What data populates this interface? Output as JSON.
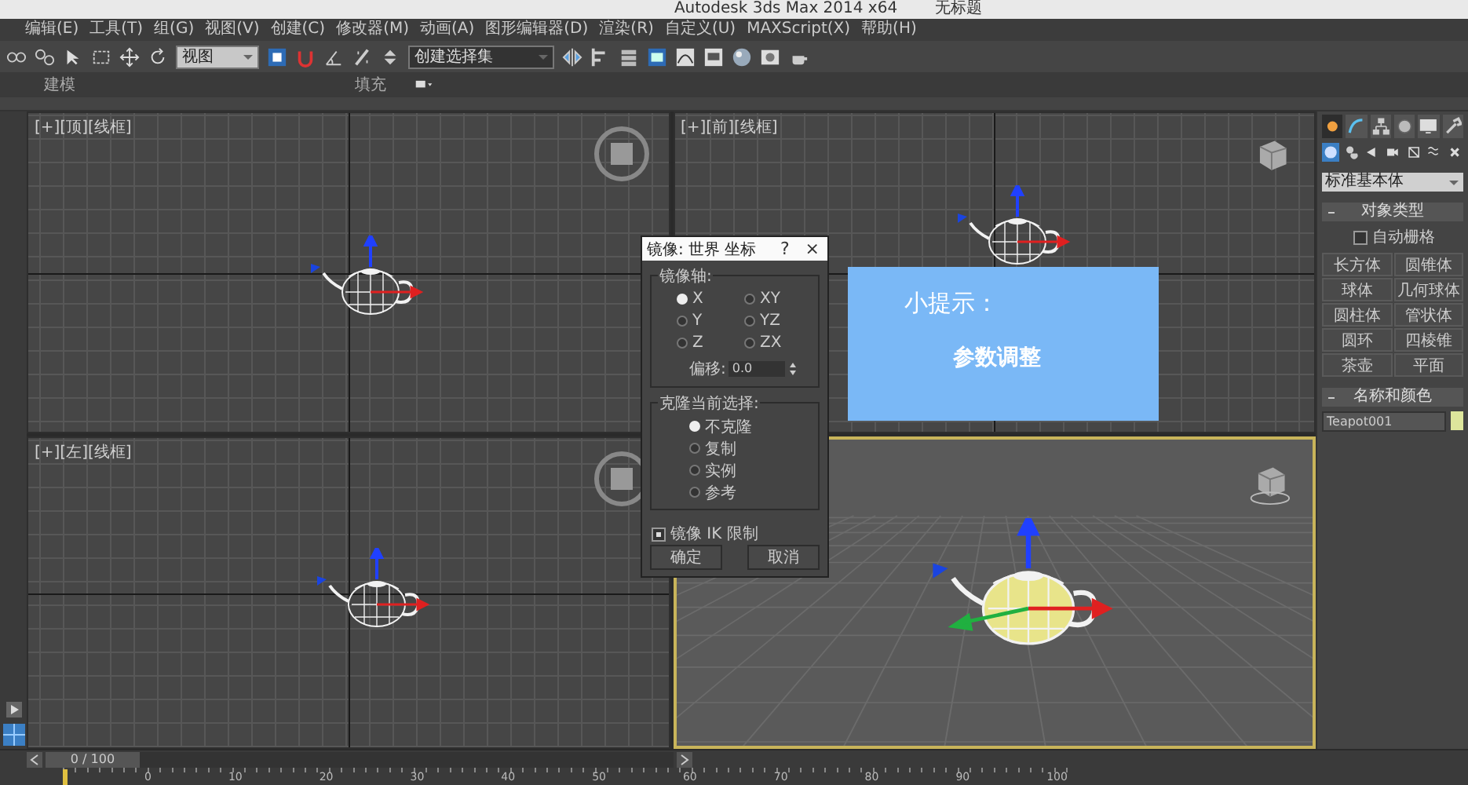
{
  "window": {
    "title": "Autodesk 3ds Max  2014 x64",
    "document": "无标题"
  },
  "menu": [
    "编辑(E)",
    "工具(T)",
    "组(G)",
    "视图(V)",
    "创建(C)",
    "修改器(M)",
    "动画(A)",
    "图形编辑器(D)",
    "渲染(R)",
    "自定义(U)",
    "MAXScript(X)",
    "帮助(H)"
  ],
  "toolbar": {
    "view_dropdown": "视图",
    "selection_set_dropdown": "创建选择集"
  },
  "ribbon_tabs": [
    "建模",
    "填充"
  ],
  "viewports": [
    {
      "label": "[+][顶][线框]",
      "kind": "wire",
      "active": false
    },
    {
      "label": "[+][前][线框]",
      "kind": "wire",
      "active": false
    },
    {
      "label": "[+][左][线框]",
      "kind": "wire",
      "active": false
    },
    {
      "kind": "shaded",
      "active": true
    }
  ],
  "dialog": {
    "title": "镜像: 世界 坐标",
    "help": "?",
    "close": "×",
    "axis_group": "镜像轴:",
    "axes": [
      {
        "label": "X",
        "selected": true
      },
      {
        "label": "XY",
        "selected": false
      },
      {
        "label": "Y",
        "selected": false
      },
      {
        "label": "YZ",
        "selected": false
      },
      {
        "label": "Z",
        "selected": false
      },
      {
        "label": "ZX",
        "selected": false
      }
    ],
    "offset_label": "偏移:",
    "offset_value": "0.0",
    "clone_group": "克隆当前选择:",
    "clone_options": [
      {
        "label": "不克隆",
        "selected": true
      },
      {
        "label": "复制",
        "selected": false
      },
      {
        "label": "实例",
        "selected": false
      },
      {
        "label": "参考",
        "selected": false
      }
    ],
    "ik": {
      "label": "镜像 IK 限制",
      "checked": true
    },
    "buttons": [
      "确定",
      "取消"
    ]
  },
  "tip": {
    "title": "小提示：",
    "body": "参数调整"
  },
  "command_panel": {
    "category": "标准基本体",
    "object_type_title": "对象类型",
    "autogrid": {
      "label": "自动栅格",
      "checked": false
    },
    "objects": [
      "长方体",
      "圆锥体",
      "球体",
      "几何球体",
      "圆柱体",
      "管状体",
      "圆环",
      "四棱锥",
      "茶壶",
      "平面"
    ],
    "name_color_title": "名称和颜色",
    "name": "Teapot001"
  },
  "timeline": {
    "frame": "0 / 100",
    "level": 0,
    "ticks": [
      "0",
      "10",
      "20",
      "30",
      "40",
      "50",
      "60",
      "70",
      "80",
      "90",
      "100"
    ]
  }
}
